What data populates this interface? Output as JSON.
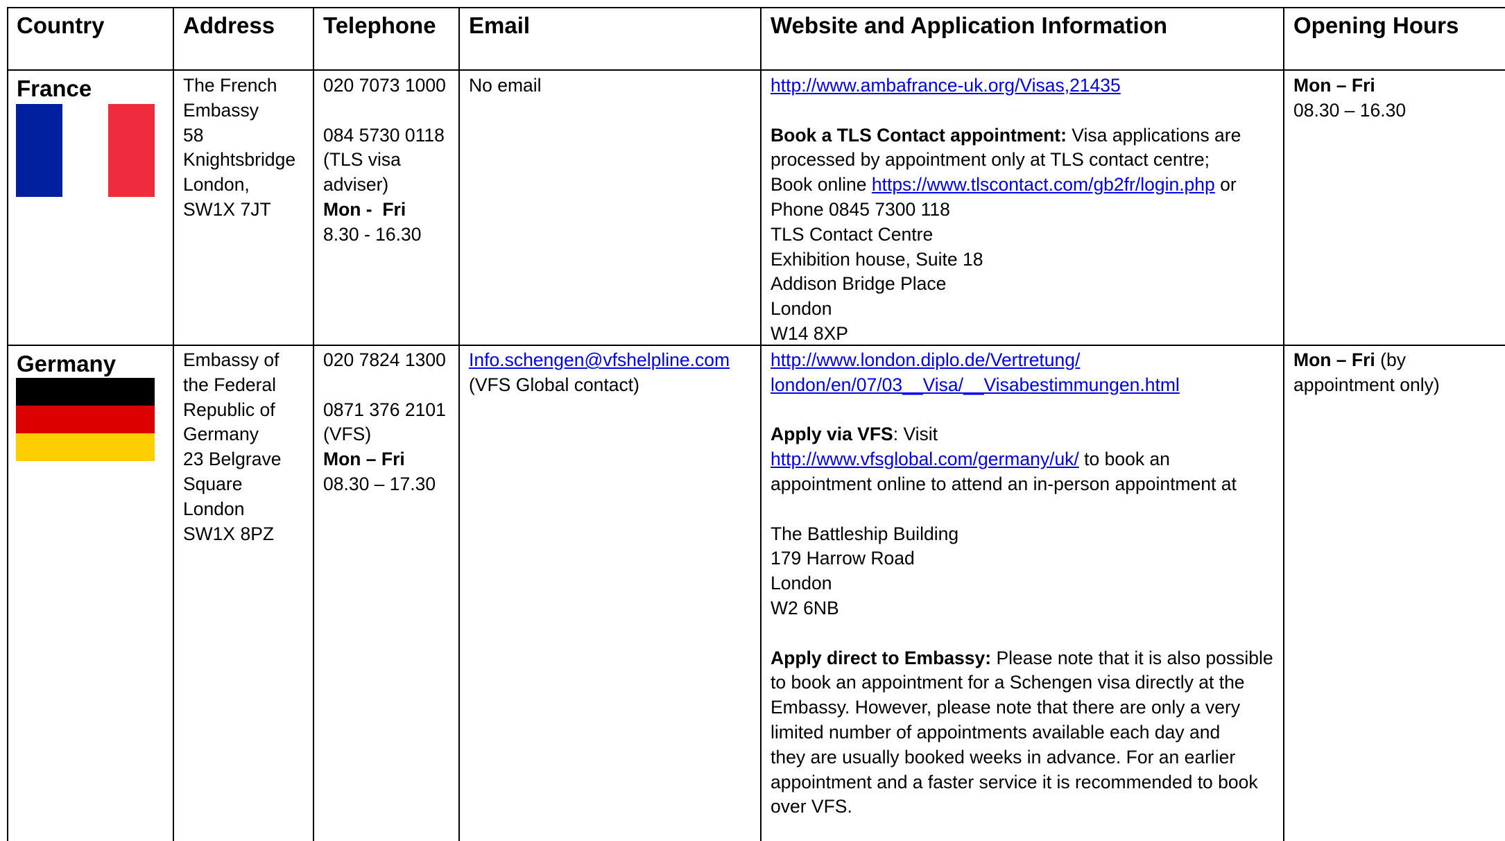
{
  "headers": {
    "country": "Country",
    "address": "Address",
    "telephone": "Telephone",
    "email": "Email",
    "website": "Website and Application Information",
    "hours": "Opening Hours"
  },
  "france": {
    "country": "France",
    "flag_colors": [
      "#00209f",
      "#ffffff",
      "#ef2b3d"
    ],
    "address": [
      "The French",
      "Embassy",
      "58",
      "Knightsbridge",
      "London,",
      "SW1X 7JT"
    ],
    "tel1": "020 7073 1000",
    "tel2": "084 5730 0118",
    "tel3": "(TLS visa",
    "tel4": "adviser)",
    "tel_days": "Mon -  Fri",
    "tel_hours": "8.30 - 16.30",
    "email": "No email",
    "web_link": "http://www.ambafrance-uk.org/Visas,21435",
    "book_label": "Book a TLS Contact appointment:",
    "book_text1": " Visa applications are",
    "book_text2": "processed by appointment only at TLS contact centre;",
    "book_online": "Book online ",
    "tls_link": "https://www.tlscontact.com/gb2fr/login.php",
    "or": " or",
    "phone": "Phone 0845 7300 118",
    "centre": "TLS Contact Centre",
    "addr1": "Exhibition house, Suite 18",
    "addr2": "Addison Bridge Place",
    "addr3": "London",
    "addr4": "W14 8XP",
    "hours_days": "Mon – Fri",
    "hours_time": "08.30 – 16.30"
  },
  "germany": {
    "country": "Germany",
    "flag_colors": [
      "#000000",
      "#dd0000",
      "#ffce00"
    ],
    "address": [
      "Embassy of",
      "the Federal",
      "Republic of",
      "Germany",
      "23 Belgrave",
      "Square",
      "London",
      "SW1X 8PZ"
    ],
    "tel1": "020 7824 1300",
    "tel2": "0871 376 2101",
    "tel3": "(VFS)",
    "tel_days": "Mon – Fri",
    "tel_hours": "08.30 – 17.30",
    "email_link": "Info.schengen@vfshelpline.com",
    "email_note": "(VFS Global contact)",
    "web_link1": "http://www.london.diplo.de/Vertretung/",
    "web_link2": "london/en/07/03__Visa/__Visabestimmungen.html",
    "vfs_label": "Apply via VFS",
    "vfs_colon": ": Visit",
    "vfs_link": "http://www.vfsglobal.com/germany/uk/",
    "vfs_text1": " to book an",
    "vfs_text2": "appointment online to attend an in-person appointment at",
    "b1": "The Battleship Building",
    "b2": "179 Harrow Road",
    "b3": "London",
    "b4": "W2 6NB",
    "direct_label": "Apply direct to Embassy:",
    "direct_text": [
      " Please note that it is also possible",
      "to book an appointment for a Schengen visa directly at the",
      "Embassy. However, please note that there are only a very",
      "limited number of appointments available each day and",
      "they are usually booked weeks in advance. For an earlier",
      "appointment and a faster service it is recommended to book",
      "over VFS."
    ],
    "hours_days": "Mon – Fri",
    "hours_note1": " (by",
    "hours_note2": "appointment only)"
  }
}
